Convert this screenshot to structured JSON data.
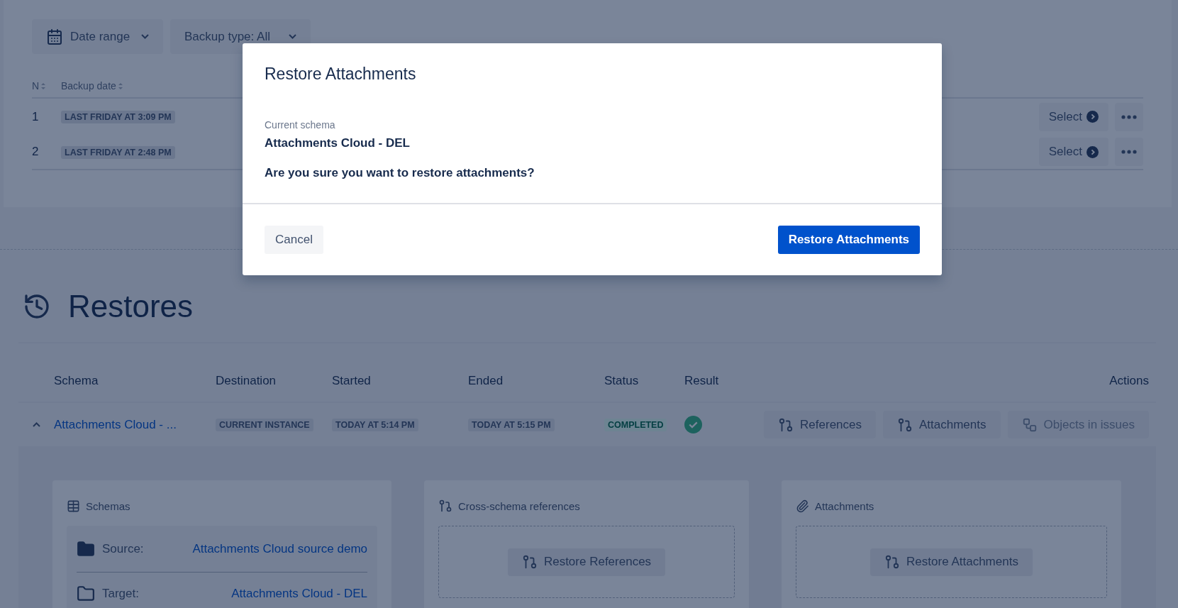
{
  "filters": [
    {
      "label": "Date range",
      "kind": "calendar"
    },
    {
      "label": "Backup type: All",
      "kind": "plain"
    }
  ],
  "backups": {
    "columns": [
      "N",
      "Backup date"
    ],
    "rows": [
      {
        "n": "1",
        "date": "LAST FRIDAY AT 3:09 PM",
        "action": "Select"
      },
      {
        "n": "2",
        "date": "LAST FRIDAY AT 2:48 PM",
        "action": "Select"
      }
    ]
  },
  "restores": {
    "title": "Restores",
    "columns": [
      "Schema",
      "Destination",
      "Started",
      "Ended",
      "Status",
      "Result",
      "Actions"
    ],
    "rows": [
      {
        "expanded": true,
        "schema": "Attachments Cloud - ...",
        "destination": "CURRENT INSTANCE",
        "started": "TODAY AT 5:14 PM",
        "ended": "TODAY AT 5:15 PM",
        "status": "COMPLETED",
        "result_ok": true,
        "actions": [
          {
            "label": "References",
            "kind": "branch",
            "disabled": false
          },
          {
            "label": "Attachments",
            "kind": "branch",
            "disabled": false
          },
          {
            "label": "Objects in issues",
            "kind": "flow",
            "disabled": true
          }
        ]
      }
    ]
  },
  "details": [
    {
      "kind": "schemas",
      "title": "Schemas",
      "rows": [
        {
          "label": "Source:",
          "value": "Attachments Cloud source demo",
          "kind": "filled"
        },
        {
          "label": "Target:",
          "value": "Attachments Cloud - DEL",
          "kind": "outline"
        }
      ]
    },
    {
      "kind": "references",
      "title": "Cross-schema references",
      "button": "Restore References"
    },
    {
      "kind": "attachments",
      "title": "Attachments",
      "button": "Restore Attachments"
    }
  ],
  "dialog": {
    "title": "Restore Attachments",
    "field_label": "Current schema",
    "field_value": "Attachments Cloud - DEL",
    "question": "Are you sure you want to restore attachments?",
    "cancel": "Cancel",
    "confirm": "Restore Attachments"
  }
}
